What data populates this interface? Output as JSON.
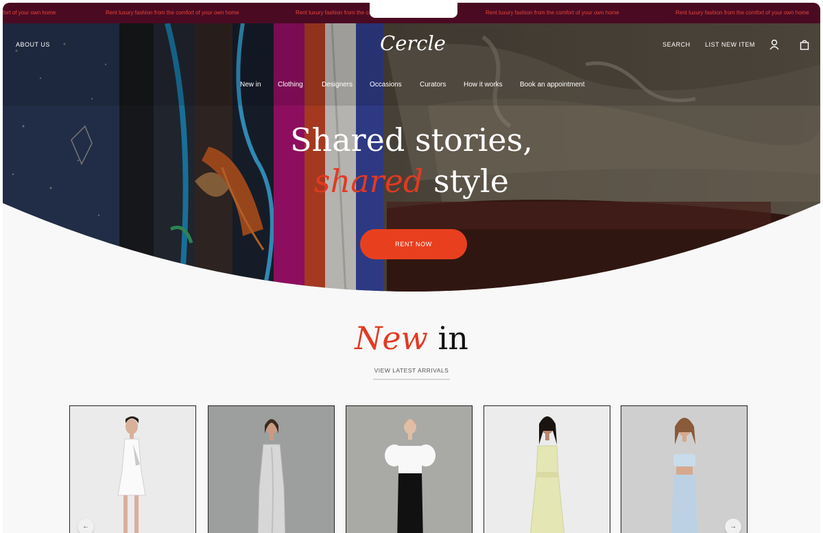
{
  "announcement": {
    "message": "Rent luxury fashion from the comfort of your own home",
    "message_clipped": "fort of your own home"
  },
  "header": {
    "logo": "Cercle",
    "about_label": "ABOUT US",
    "search_label": "SEARCH",
    "list_item_label": "LIST NEW ITEM",
    "account_icon": "user-icon",
    "bag_icon": "shopping-bag-icon"
  },
  "nav": {
    "items": [
      {
        "label": "New in"
      },
      {
        "label": "Clothing"
      },
      {
        "label": "Designers"
      },
      {
        "label": "Occasions"
      },
      {
        "label": "Curators"
      },
      {
        "label": "How it works"
      },
      {
        "label": "Book an appointment"
      }
    ]
  },
  "hero": {
    "line1": "Shared stories,",
    "line2_accent": "shared",
    "line2_rest": " style",
    "cta_label": "RENT NOW"
  },
  "new_in": {
    "title_accent": "New",
    "title_rest": " in",
    "link_label": "VIEW LATEST ARRIVALS",
    "prev_icon": "arrow-left-icon",
    "next_icon": "arrow-right-icon",
    "products": [
      {
        "dress": "white sequin halter mini dress",
        "bg": "#ebebeb"
      },
      {
        "dress": "silver satin slip dress",
        "bg": "#9d9e9e"
      },
      {
        "dress": "white puff-sleeve and black column dress",
        "bg": "#a9a9a6"
      },
      {
        "dress": "pale yellow midi dress",
        "bg": "#ececec"
      },
      {
        "dress": "light blue sequin two-piece",
        "bg": "#cfcfcf"
      }
    ]
  },
  "colors": {
    "accent": "#e8401f",
    "marquee_bg": "#4a0a22",
    "marquee_text": "#e5453a"
  }
}
